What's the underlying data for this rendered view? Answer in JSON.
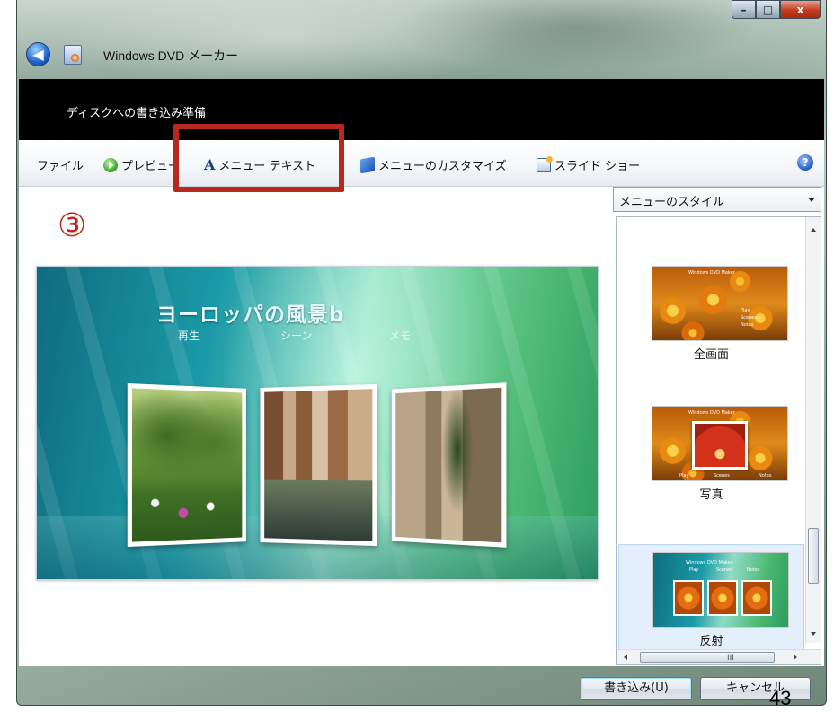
{
  "window": {
    "title": "Windows DVD メーカー",
    "caption_buttons": {
      "minimize": "–",
      "maximize": "□",
      "close": "x"
    }
  },
  "header": {
    "step_title": "ディスクへの書き込み準備"
  },
  "toolbar": {
    "file": "ファイル",
    "preview": "プレビュー",
    "menu_text": "メニュー テキスト",
    "customize_menu": "メニューのカスタマイズ",
    "slide_show": "スライド ショー",
    "help": "?"
  },
  "annotation": {
    "step_marker": "③",
    "highlight_color": "#b7291d"
  },
  "preview": {
    "disc_title": "ヨーロッパの風景b",
    "links": [
      "再生",
      "シーン",
      "メモ"
    ]
  },
  "styles_panel": {
    "dropdown_label": "メニューのスタイル",
    "items": [
      {
        "label": "全画面",
        "thumb_title": "Windows DVD Maker",
        "thumb_links": [
          "Play",
          "Scenes",
          "Notes"
        ]
      },
      {
        "label": "写真",
        "thumb_title": "Windows DVD Maker",
        "thumb_links": [
          "Play",
          "Scenes",
          "Notes"
        ]
      },
      {
        "label": "反射",
        "thumb_title": "Windows DVD Maker",
        "thumb_links": [
          "Play",
          "Scenes",
          "Notes"
        ],
        "selected": true
      }
    ],
    "hscroll_grip": "III"
  },
  "buttons": {
    "write": "書き込み(U)",
    "cancel": "キャンセル"
  },
  "page_number": "43",
  "colors": {
    "header_band": "#000000",
    "accent_red": "#b7291d"
  }
}
